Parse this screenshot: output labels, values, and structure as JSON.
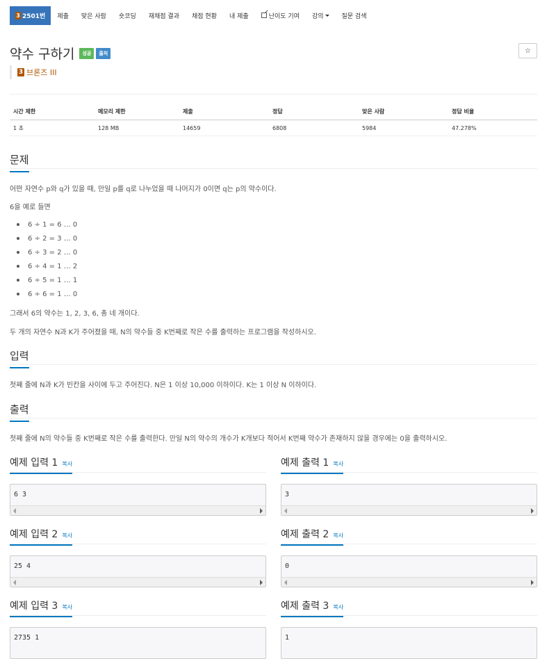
{
  "nav": {
    "problem_id": "2501번",
    "tier_badge": "3",
    "items": [
      "제출",
      "맞은 사람",
      "숏코딩",
      "재채점 결과",
      "채점 현황",
      "내 제출",
      "난이도 기여",
      "강의",
      "질문 검색"
    ]
  },
  "title": "약수 구하기",
  "labels": {
    "success": "성공",
    "multi": "출처"
  },
  "star_icon": "☆",
  "tier": {
    "badge": "3",
    "name": "브론즈 III",
    "color": "#ad5600"
  },
  "stats": {
    "headers": [
      "시간 제한",
      "메모리 제한",
      "제출",
      "정답",
      "맞은 사람",
      "정답 비율"
    ],
    "values": [
      "1 초",
      "128 MB",
      "14659",
      "6808",
      "5984",
      "47.278%"
    ]
  },
  "problem": {
    "heading": "문제",
    "p1": "어떤 자연수 p와 q가 있을 때, 만일 p를 q로 나누었을 때 나머지가 0이면 q는 p의 약수이다.",
    "p2": "6을 예로 들면",
    "list": [
      "6 ÷ 1 = 6 … 0",
      "6 ÷ 2 = 3 … 0",
      "6 ÷ 3 = 2 … 0",
      "6 ÷ 4 = 1 … 2",
      "6 ÷ 5 = 1 … 1",
      "6 ÷ 6 = 1 … 0"
    ],
    "p3": "그래서 6의 약수는 1, 2, 3, 6, 총 네 개이다.",
    "p4": "두 개의 자연수 N과 K가 주어졌을 때, N의 약수들 중 K번째로 작은 수를 출력하는 프로그램을 작성하시오."
  },
  "input": {
    "heading": "입력",
    "text": "첫째 줄에 N과 K가 빈칸을 사이에 두고 주어진다. N은 1 이상 10,000 이하이다. K는 1 이상 N 이하이다."
  },
  "output": {
    "heading": "출력",
    "text": "첫째 줄에 N의 약수들 중 K번째로 작은 수를 출력한다. 만일 N의 약수의 개수가 K개보다 적어서 K번째 약수가 존재하지 않을 경우에는 0을 출력하시오."
  },
  "copy_label": "복사",
  "samples": [
    {
      "input_title": "예제 입력 1",
      "output_title": "예제 출력 1",
      "input": "6 3",
      "output": "3"
    },
    {
      "input_title": "예제 입력 2",
      "output_title": "예제 출력 2",
      "input": "25 4",
      "output": "0"
    },
    {
      "input_title": "예제 입력 3",
      "output_title": "예제 출력 3",
      "input": "2735 1",
      "output": "1"
    }
  ]
}
